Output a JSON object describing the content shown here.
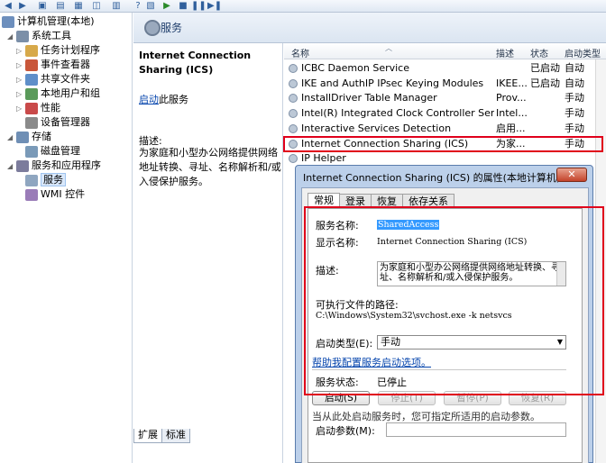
{
  "tree": {
    "root": "计算机管理(本地)",
    "items": [
      {
        "label": "系统工具",
        "level": 1,
        "exp": "◢",
        "icon": "tools-icon"
      },
      {
        "label": "任务计划程序",
        "level": 2,
        "exp": "▷",
        "icon": "clock-icon"
      },
      {
        "label": "事件查看器",
        "level": 2,
        "exp": "▷",
        "icon": "event-viewer-icon"
      },
      {
        "label": "共享文件夹",
        "level": 2,
        "exp": "▷",
        "icon": "shared-folder-icon"
      },
      {
        "label": "本地用户和组",
        "level": 2,
        "exp": "▷",
        "icon": "users-icon"
      },
      {
        "label": "性能",
        "level": 2,
        "exp": "▷",
        "icon": "performance-icon"
      },
      {
        "label": "设备管理器",
        "level": 2,
        "exp": "",
        "icon": "device-manager-icon"
      },
      {
        "label": "存储",
        "level": 1,
        "exp": "◢",
        "icon": "storage-icon"
      },
      {
        "label": "磁盘管理",
        "level": 2,
        "exp": "",
        "icon": "disk-icon"
      },
      {
        "label": "服务和应用程序",
        "level": 1,
        "exp": "◢",
        "icon": "services-apps-icon"
      },
      {
        "label": "服务",
        "level": 2,
        "exp": "",
        "icon": "gear-icon",
        "selected": true
      },
      {
        "label": "WMI 控件",
        "level": 2,
        "exp": "",
        "icon": "wmi-icon"
      }
    ]
  },
  "header": {
    "title": "服务"
  },
  "detail": {
    "service_title": "Internet Connection Sharing (ICS)",
    "start_link": "启动",
    "start_suffix": "此服务",
    "desc_label": "描述:",
    "desc_text": "为家庭和小型办公网络提供网络地址转换、寻址、名称解析和/或入侵保护服务。"
  },
  "bottom_tabs": [
    "扩展",
    "标准"
  ],
  "list": {
    "headers": [
      "名称",
      "描述",
      "状态",
      "启动类型"
    ],
    "rows": [
      {
        "name": "ICBC Daemon Service",
        "desc": "",
        "status": "已启动",
        "startup": "自动"
      },
      {
        "name": "IKE and AuthIP IPsec Keying Modules",
        "desc": "IKEE...",
        "status": "已启动",
        "startup": "自动"
      },
      {
        "name": "InstallDriver Table Manager",
        "desc": "Prov...",
        "status": "",
        "startup": "手动"
      },
      {
        "name": "Intel(R) Integrated Clock Controller Service ...",
        "desc": "Intel...",
        "status": "",
        "startup": "手动"
      },
      {
        "name": "Interactive Services Detection",
        "desc": "启用...",
        "status": "",
        "startup": "手动"
      },
      {
        "name": "Internet Connection Sharing (ICS)",
        "desc": "为家...",
        "status": "",
        "startup": "手动"
      },
      {
        "name": "IP Helper",
        "desc": "",
        "status": "",
        "startup": ""
      }
    ]
  },
  "dialog": {
    "title": "Internet Connection Sharing (ICS) 的属性(本地计算机)",
    "close": "✕",
    "tabs": [
      "常规",
      "登录",
      "恢复",
      "依存关系"
    ],
    "service_name_label": "服务名称:",
    "service_name": "SharedAccess",
    "display_name_label": "显示名称:",
    "display_name": "Internet Connection Sharing (ICS)",
    "description_label": "描述:",
    "description": "为家庭和小型办公网络提供网络地址转换、寻址、名称解析和/或入侵保护服务。",
    "path_label": "可执行文件的路径:",
    "path": "C:\\Windows\\System32\\svchost.exe -k netsvcs",
    "startup_type_label": "启动类型(E):",
    "startup_type": "手动",
    "help_link": "帮助我配置服务启动选项。",
    "status_label": "服务状态:",
    "status": "已停止",
    "buttons": {
      "start": "启动(S)",
      "stop": "停止(T)",
      "pause": "暂停(P)",
      "resume": "恢复(R)"
    },
    "note": "当从此处启动服务时，您可指定所适用的启动参数。",
    "params_label": "启动参数(M):"
  }
}
